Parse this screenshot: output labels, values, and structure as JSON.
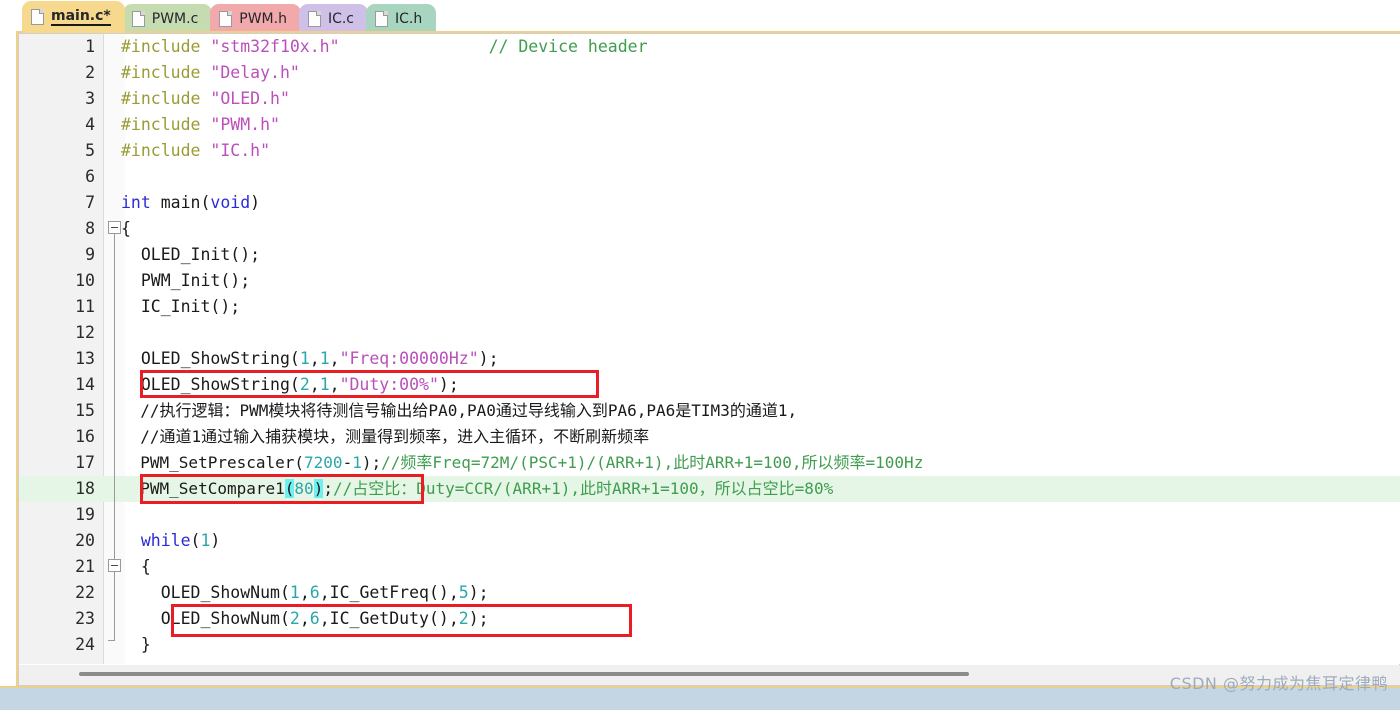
{
  "window": {
    "title": "main.c",
    "watermark": "CSDN @努力成为焦耳定律鸭"
  },
  "tabs": [
    {
      "label": "main.c*",
      "color": "#f6d98c",
      "active": true,
      "icon": "file-icon"
    },
    {
      "label": "PWM.c",
      "color": "#c5dcb1",
      "active": false,
      "icon": "file-icon"
    },
    {
      "label": "PWM.h",
      "color": "#f2a9ac",
      "active": false,
      "icon": "file-icon"
    },
    {
      "label": "IC.c",
      "color": "#cfc0e8",
      "active": false,
      "icon": "file-icon"
    },
    {
      "label": "IC.h",
      "color": "#a8d5bf",
      "active": false,
      "icon": "file-icon"
    }
  ],
  "editor": {
    "language": "C",
    "current_line": 18,
    "colors": {
      "preprocessor": "#9b9b35",
      "string": "#bb4fbb",
      "comment": "#3f9d4f",
      "keyword": "#2b2bd6",
      "number": "#2aa7a7",
      "plain": "#1a1a1a",
      "current_line_bg": "#e6f6e6",
      "brace_match_bg": "#6ff0f0",
      "annotation": "#ea1c24",
      "gutter_bg": "#f2f2f2",
      "tab_active": "#f6d98c"
    },
    "lines": [
      {
        "n": "1",
        "text": "#include \"stm32f10x.h\"                // Device header"
      },
      {
        "n": "2",
        "text": "#include \"Delay.h\""
      },
      {
        "n": "3",
        "text": "#include \"OLED.h\""
      },
      {
        "n": "4",
        "text": "#include \"PWM.h\""
      },
      {
        "n": "5",
        "text": "#include \"IC.h\""
      },
      {
        "n": "6",
        "text": ""
      },
      {
        "n": "7",
        "text": "int main(void)"
      },
      {
        "n": "8",
        "text": "{"
      },
      {
        "n": "9",
        "text": "  OLED_Init();"
      },
      {
        "n": "10",
        "text": "  PWM_Init();"
      },
      {
        "n": "11",
        "text": "  IC_Init();"
      },
      {
        "n": "12",
        "text": ""
      },
      {
        "n": "13",
        "text": "  OLED_ShowString(1,1,\"Freq:00000Hz\");"
      },
      {
        "n": "14",
        "text": "  OLED_ShowString(2,1,\"Duty:00%\");"
      },
      {
        "n": "15",
        "text": "  //执行逻辑：PWM模块将待测信号输出给PA0,PA0通过导线输入到PA6,PA6是TIM3的通道1,"
      },
      {
        "n": "16",
        "text": "  //通道1通过输入捕获模块，测量得到频率，进入主循环，不断刷新频率"
      },
      {
        "n": "17",
        "text": "  PWM_SetPrescaler(7200-1);//频率Freq=72M/(PSC+1)/(ARR+1),此时ARR+1=100,所以频率=100Hz"
      },
      {
        "n": "18",
        "text": "  PWM_SetCompare1(80);//占空比：Duty=CCR/(ARR+1),此时ARR+1=100，所以占空比=80%"
      },
      {
        "n": "19",
        "text": ""
      },
      {
        "n": "20",
        "text": "  while(1)"
      },
      {
        "n": "21",
        "text": "  {"
      },
      {
        "n": "22",
        "text": "    OLED_ShowNum(1,6,IC_GetFreq(),5);"
      },
      {
        "n": "23",
        "text": "    OLED_ShowNum(2,6,IC_GetDuty(),2);"
      },
      {
        "n": "24",
        "text": "  }"
      }
    ],
    "annotations": [
      {
        "target_line": "14",
        "label": "red-box-line-14"
      },
      {
        "target_line": "18",
        "label": "red-box-line-18"
      },
      {
        "target_line": "23",
        "label": "red-box-line-23"
      }
    ],
    "fold_markers": [
      {
        "line": "8",
        "state": "expanded"
      },
      {
        "line": "21",
        "state": "expanded"
      }
    ],
    "scrollbar": {
      "orientation": "horizontal",
      "position": "left"
    }
  }
}
